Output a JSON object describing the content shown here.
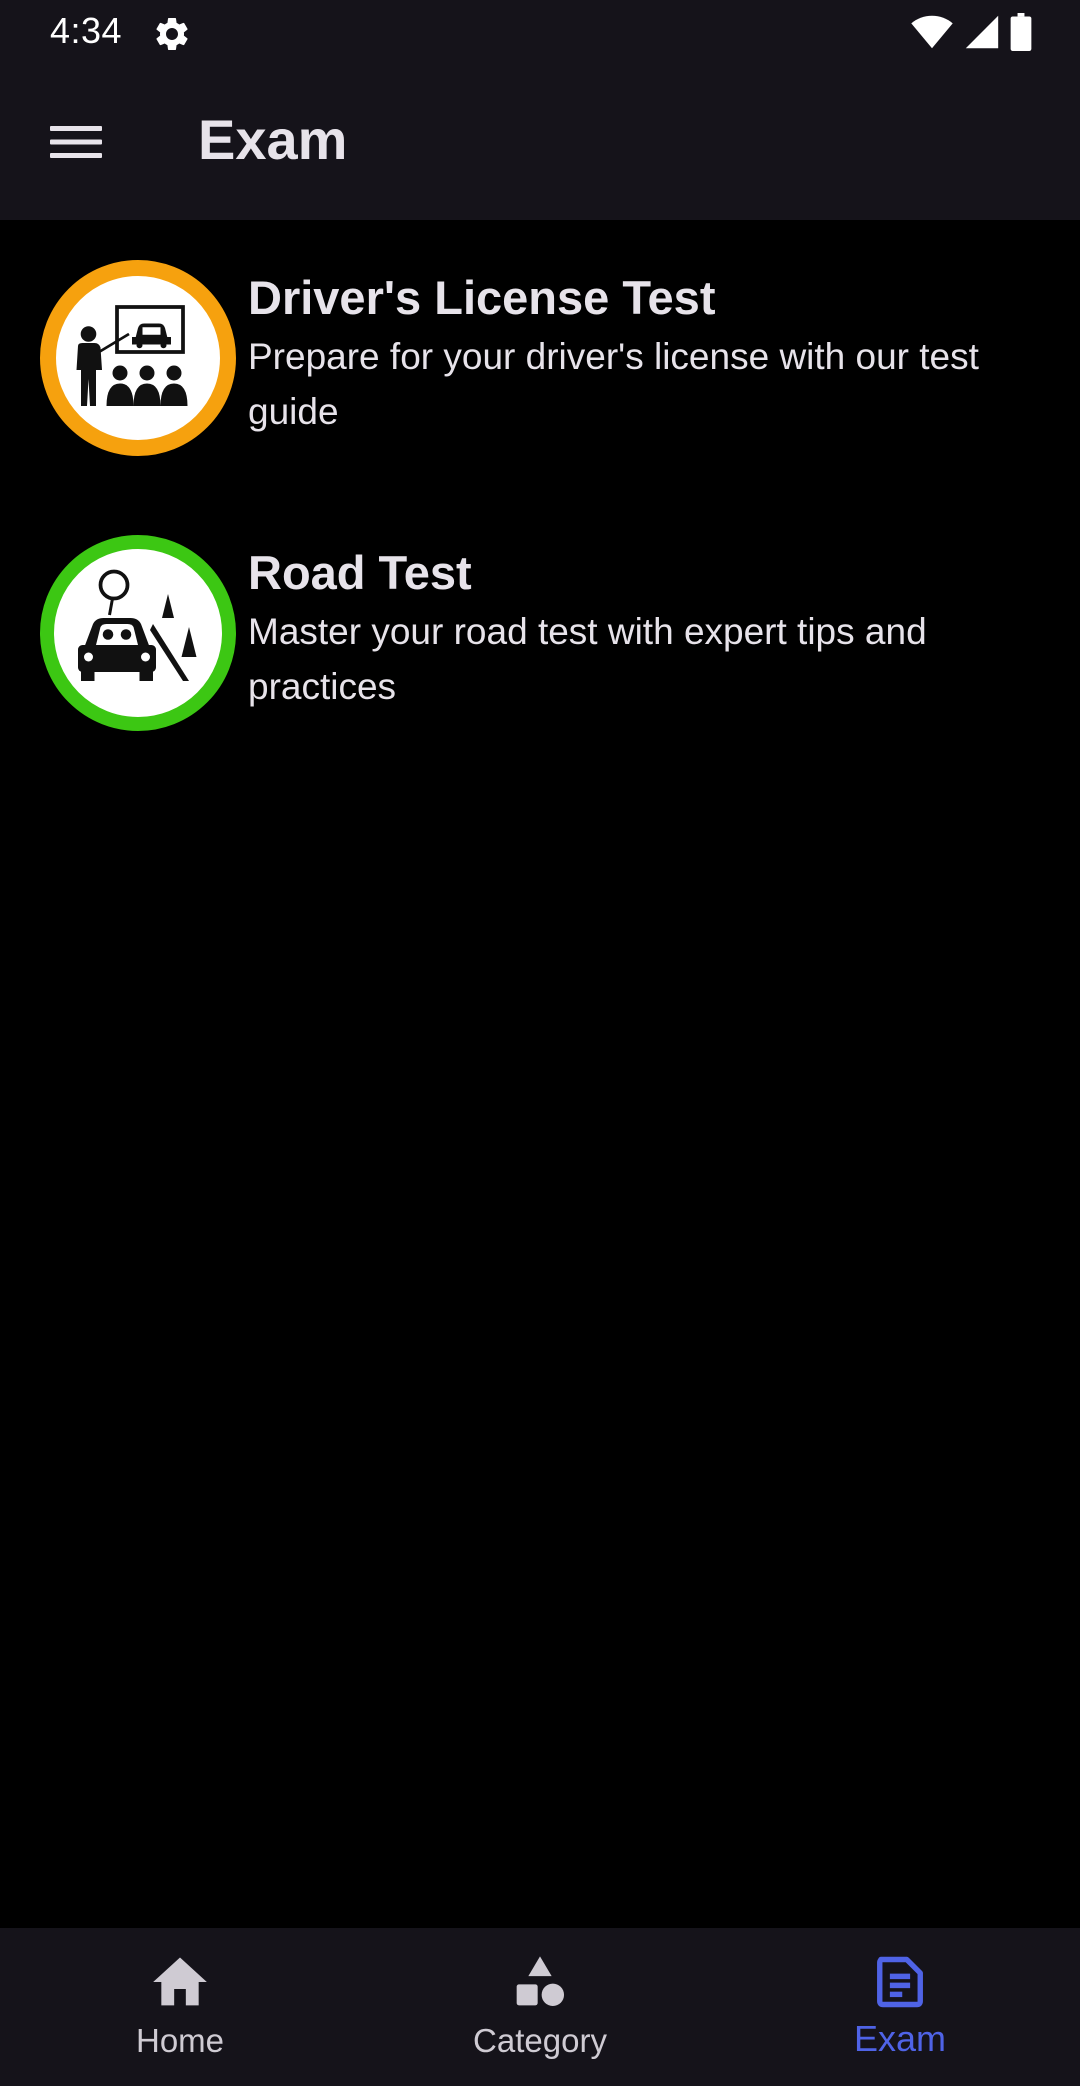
{
  "status_bar": {
    "time": "4:34",
    "icons": [
      "gear-icon",
      "wifi-icon",
      "cellular-icon",
      "battery-icon"
    ]
  },
  "app_bar": {
    "title": "Exam",
    "menu_icon": "hamburger-menu-icon"
  },
  "exams": [
    {
      "title": "Driver's License Test",
      "description": "Prepare for your driver's license with our test guide",
      "icon": "classroom-instructor-icon",
      "ring_color": "#f6a10e"
    },
    {
      "title": "Road Test",
      "description": "Master your road test with expert tips and practices",
      "icon": "driving-car-cones-icon",
      "ring_color": "#3cc713"
    }
  ],
  "bottom_nav": {
    "items": [
      {
        "label": "Home",
        "icon": "home-icon",
        "active": false
      },
      {
        "label": "Category",
        "icon": "shapes-icon",
        "active": false
      },
      {
        "label": "Exam",
        "icon": "document-icon",
        "active": true
      }
    ],
    "active_color": "#4f63e6"
  }
}
